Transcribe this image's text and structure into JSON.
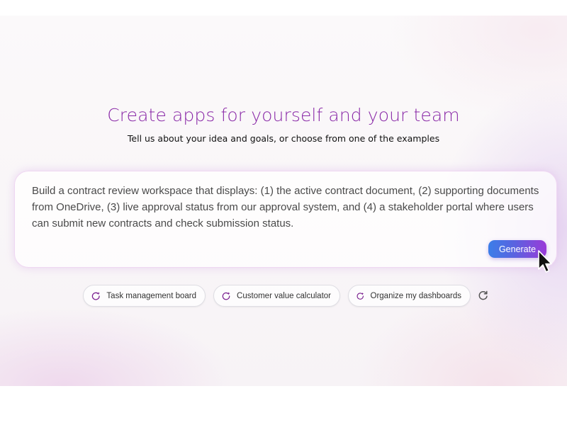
{
  "hero": {
    "title": "Create apps for yourself and your team",
    "subtitle": "Tell us about your idea and goals, or choose from one of the examples"
  },
  "prompt": {
    "text": "Build a contract review workspace that displays: (1) the active contract document, (2) supporting documents from OneDrive, (3) live approval status from our approval system, and (4) a stakeholder portal where users can submit new contracts and check submission status.",
    "generate_label": "Generate"
  },
  "examples": [
    {
      "label": "Task management board",
      "icon": "sparkle-refresh-icon"
    },
    {
      "label": "Customer value calculator",
      "icon": "sparkle-refresh-icon"
    },
    {
      "label": "Organize my dashboards",
      "icon": "sparkle-refresh-icon"
    }
  ],
  "refresh_icon": "refresh-icon",
  "colors": {
    "title": "#8a2aa8",
    "generate_gradient_start": "#3b7ee8",
    "generate_gradient_end": "#9a3ad8",
    "chip_icon": "#7a1f8f"
  }
}
